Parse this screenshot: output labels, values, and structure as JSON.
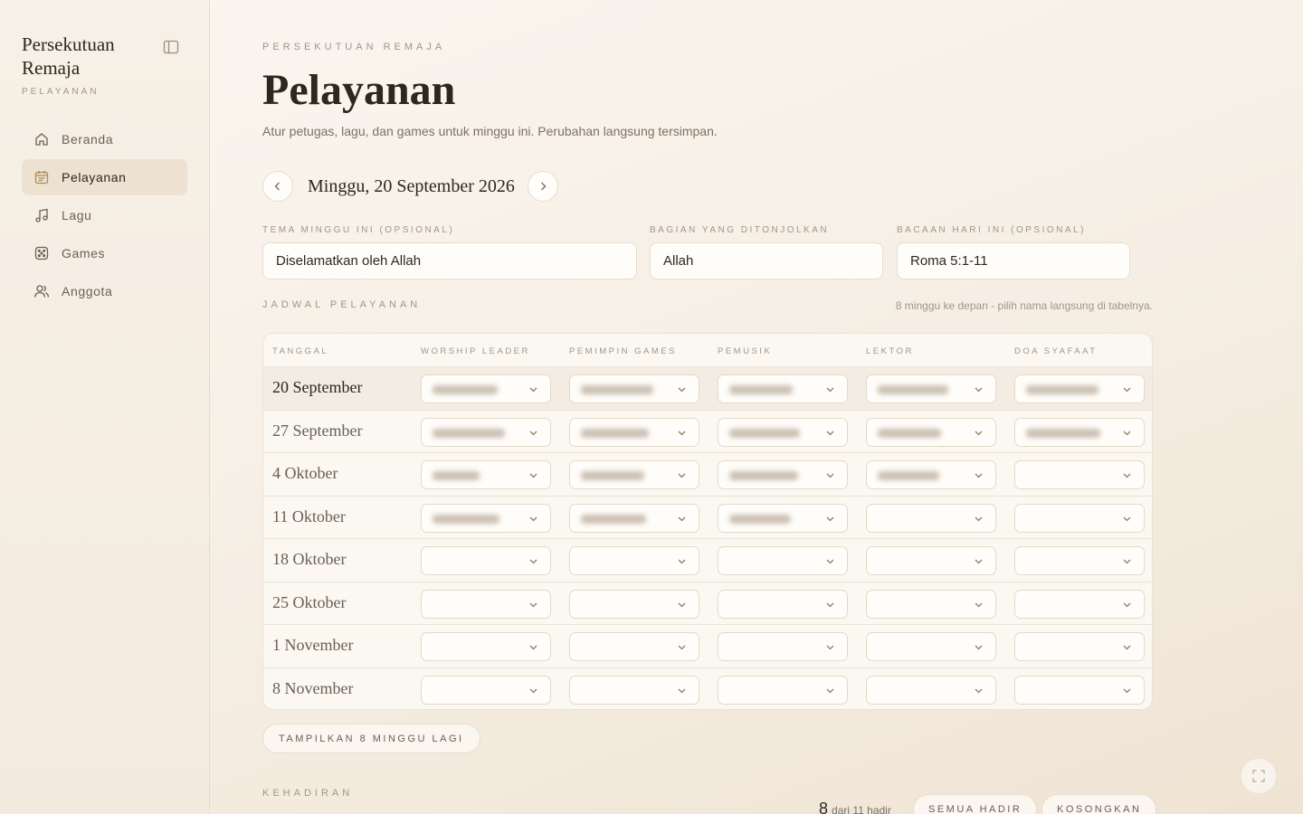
{
  "sidebar": {
    "brand_title": "Persekutuan Remaja",
    "brand_subtitle": "PELAYANAN",
    "items": [
      {
        "label": "Beranda",
        "icon": "home-icon",
        "active": false
      },
      {
        "label": "Pelayanan",
        "icon": "calendar-icon",
        "active": true
      },
      {
        "label": "Lagu",
        "icon": "music-icon",
        "active": false
      },
      {
        "label": "Games",
        "icon": "dice-icon",
        "active": false
      },
      {
        "label": "Anggota",
        "icon": "users-icon",
        "active": false
      }
    ]
  },
  "header": {
    "eyebrow": "PERSEKUTUAN REMAJA",
    "title": "Pelayanan",
    "description": "Atur petugas, lagu, dan games untuk minggu ini. Perubahan langsung tersimpan."
  },
  "date_nav": {
    "label": "Minggu, 20 September 2026"
  },
  "fields": {
    "tema": {
      "label": "TEMA MINGGU INI (OPSIONAL)",
      "value": "Diselamatkan oleh Allah"
    },
    "bagian": {
      "label": "BAGIAN YANG DITONJOLKAN",
      "value": "Allah"
    },
    "bacaan": {
      "label": "BACAAN HARI INI (OPSIONAL)",
      "value": "Roma 5:1-11"
    }
  },
  "schedule": {
    "title": "JADWAL PELAYANAN",
    "hint": "8 minggu ke depan - pilih nama langsung di tabelnya.",
    "columns": [
      "TANGGAL",
      "WORSHIP LEADER",
      "PEMIMPIN GAMES",
      "PEMUSIK",
      "LEKTOR",
      "DOA SYAFAAT"
    ],
    "rows": [
      {
        "date": "20 September",
        "filled": [
          true,
          true,
          true,
          true,
          true
        ]
      },
      {
        "date": "27 September",
        "filled": [
          true,
          true,
          true,
          true,
          true
        ]
      },
      {
        "date": "4 Oktober",
        "filled": [
          true,
          true,
          true,
          true,
          false
        ]
      },
      {
        "date": "11 Oktober",
        "filled": [
          true,
          true,
          true,
          false,
          false
        ]
      },
      {
        "date": "18 Oktober",
        "filled": [
          false,
          false,
          false,
          false,
          false
        ]
      },
      {
        "date": "25 Oktober",
        "filled": [
          false,
          false,
          false,
          false,
          false
        ]
      },
      {
        "date": "1 November",
        "filled": [
          false,
          false,
          false,
          false,
          false
        ]
      },
      {
        "date": "8 November",
        "filled": [
          false,
          false,
          false,
          false,
          false
        ]
      }
    ],
    "more_label": "TAMPILKAN 8 MINGGU LAGI"
  },
  "attendance": {
    "title": "KEHADIRAN",
    "count": "8",
    "count_suffix": "dari 11 hadir",
    "all_present_label": "SEMUA HADIR",
    "clear_label": "KOSONGKAN"
  },
  "colors": {
    "accent": "#b08a5a",
    "background": "#f7f0e6",
    "text": "#2f261e",
    "muted": "#a3958a"
  }
}
